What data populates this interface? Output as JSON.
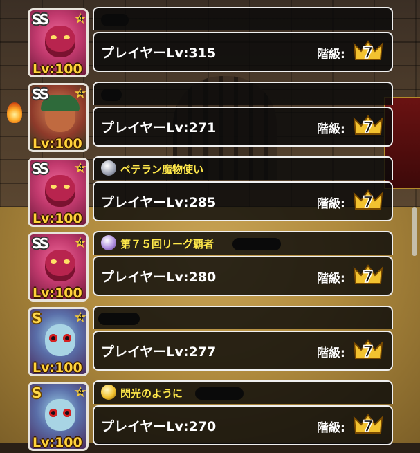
{
  "rows": [
    {
      "rank": "SS",
      "rank_style": "white",
      "portrait": "demon",
      "stars": "4",
      "monster_lv": "Lv:100",
      "title": "",
      "title_icon": "",
      "player_lv": "プレイヤーLv:315",
      "class_label": "階級:",
      "class_value": "7"
    },
    {
      "rank": "SS",
      "rank_style": "white",
      "portrait": "warrior",
      "stars": "4",
      "monster_lv": "Lv:100",
      "title": "",
      "title_icon": "",
      "player_lv": "プレイヤーLv:271",
      "class_label": "階級:",
      "class_value": "7"
    },
    {
      "rank": "SS",
      "rank_style": "white",
      "portrait": "demon",
      "stars": "4",
      "monster_lv": "Lv:100",
      "title": "ベテラン魔物使い",
      "title_icon": "silver",
      "player_lv": "プレイヤーLv:285",
      "class_label": "階級:",
      "class_value": "7"
    },
    {
      "rank": "SS",
      "rank_style": "white",
      "portrait": "demon",
      "stars": "4",
      "monster_lv": "Lv:100",
      "title": "第７５回リーグ覇者",
      "title_icon": "purple",
      "player_lv": "プレイヤーLv:280",
      "class_label": "階級:",
      "class_value": "7"
    },
    {
      "rank": "S",
      "rank_style": "gold",
      "portrait": "skull",
      "stars": "4",
      "monster_lv": "Lv:100",
      "title": "",
      "title_icon": "",
      "player_lv": "プレイヤーLv:277",
      "class_label": "階級:",
      "class_value": "7"
    },
    {
      "rank": "S",
      "rank_style": "gold",
      "portrait": "skull",
      "stars": "4",
      "monster_lv": "Lv:100",
      "title": "閃光のように",
      "title_icon": "gold",
      "player_lv": "プレイヤーLv:270",
      "class_label": "階級:",
      "class_value": "7"
    }
  ],
  "colors": {
    "title_text": "#ffe84a",
    "lv_text": "#ffd23a",
    "card_border": "#f0f0f0",
    "crown": "#f2c230"
  }
}
